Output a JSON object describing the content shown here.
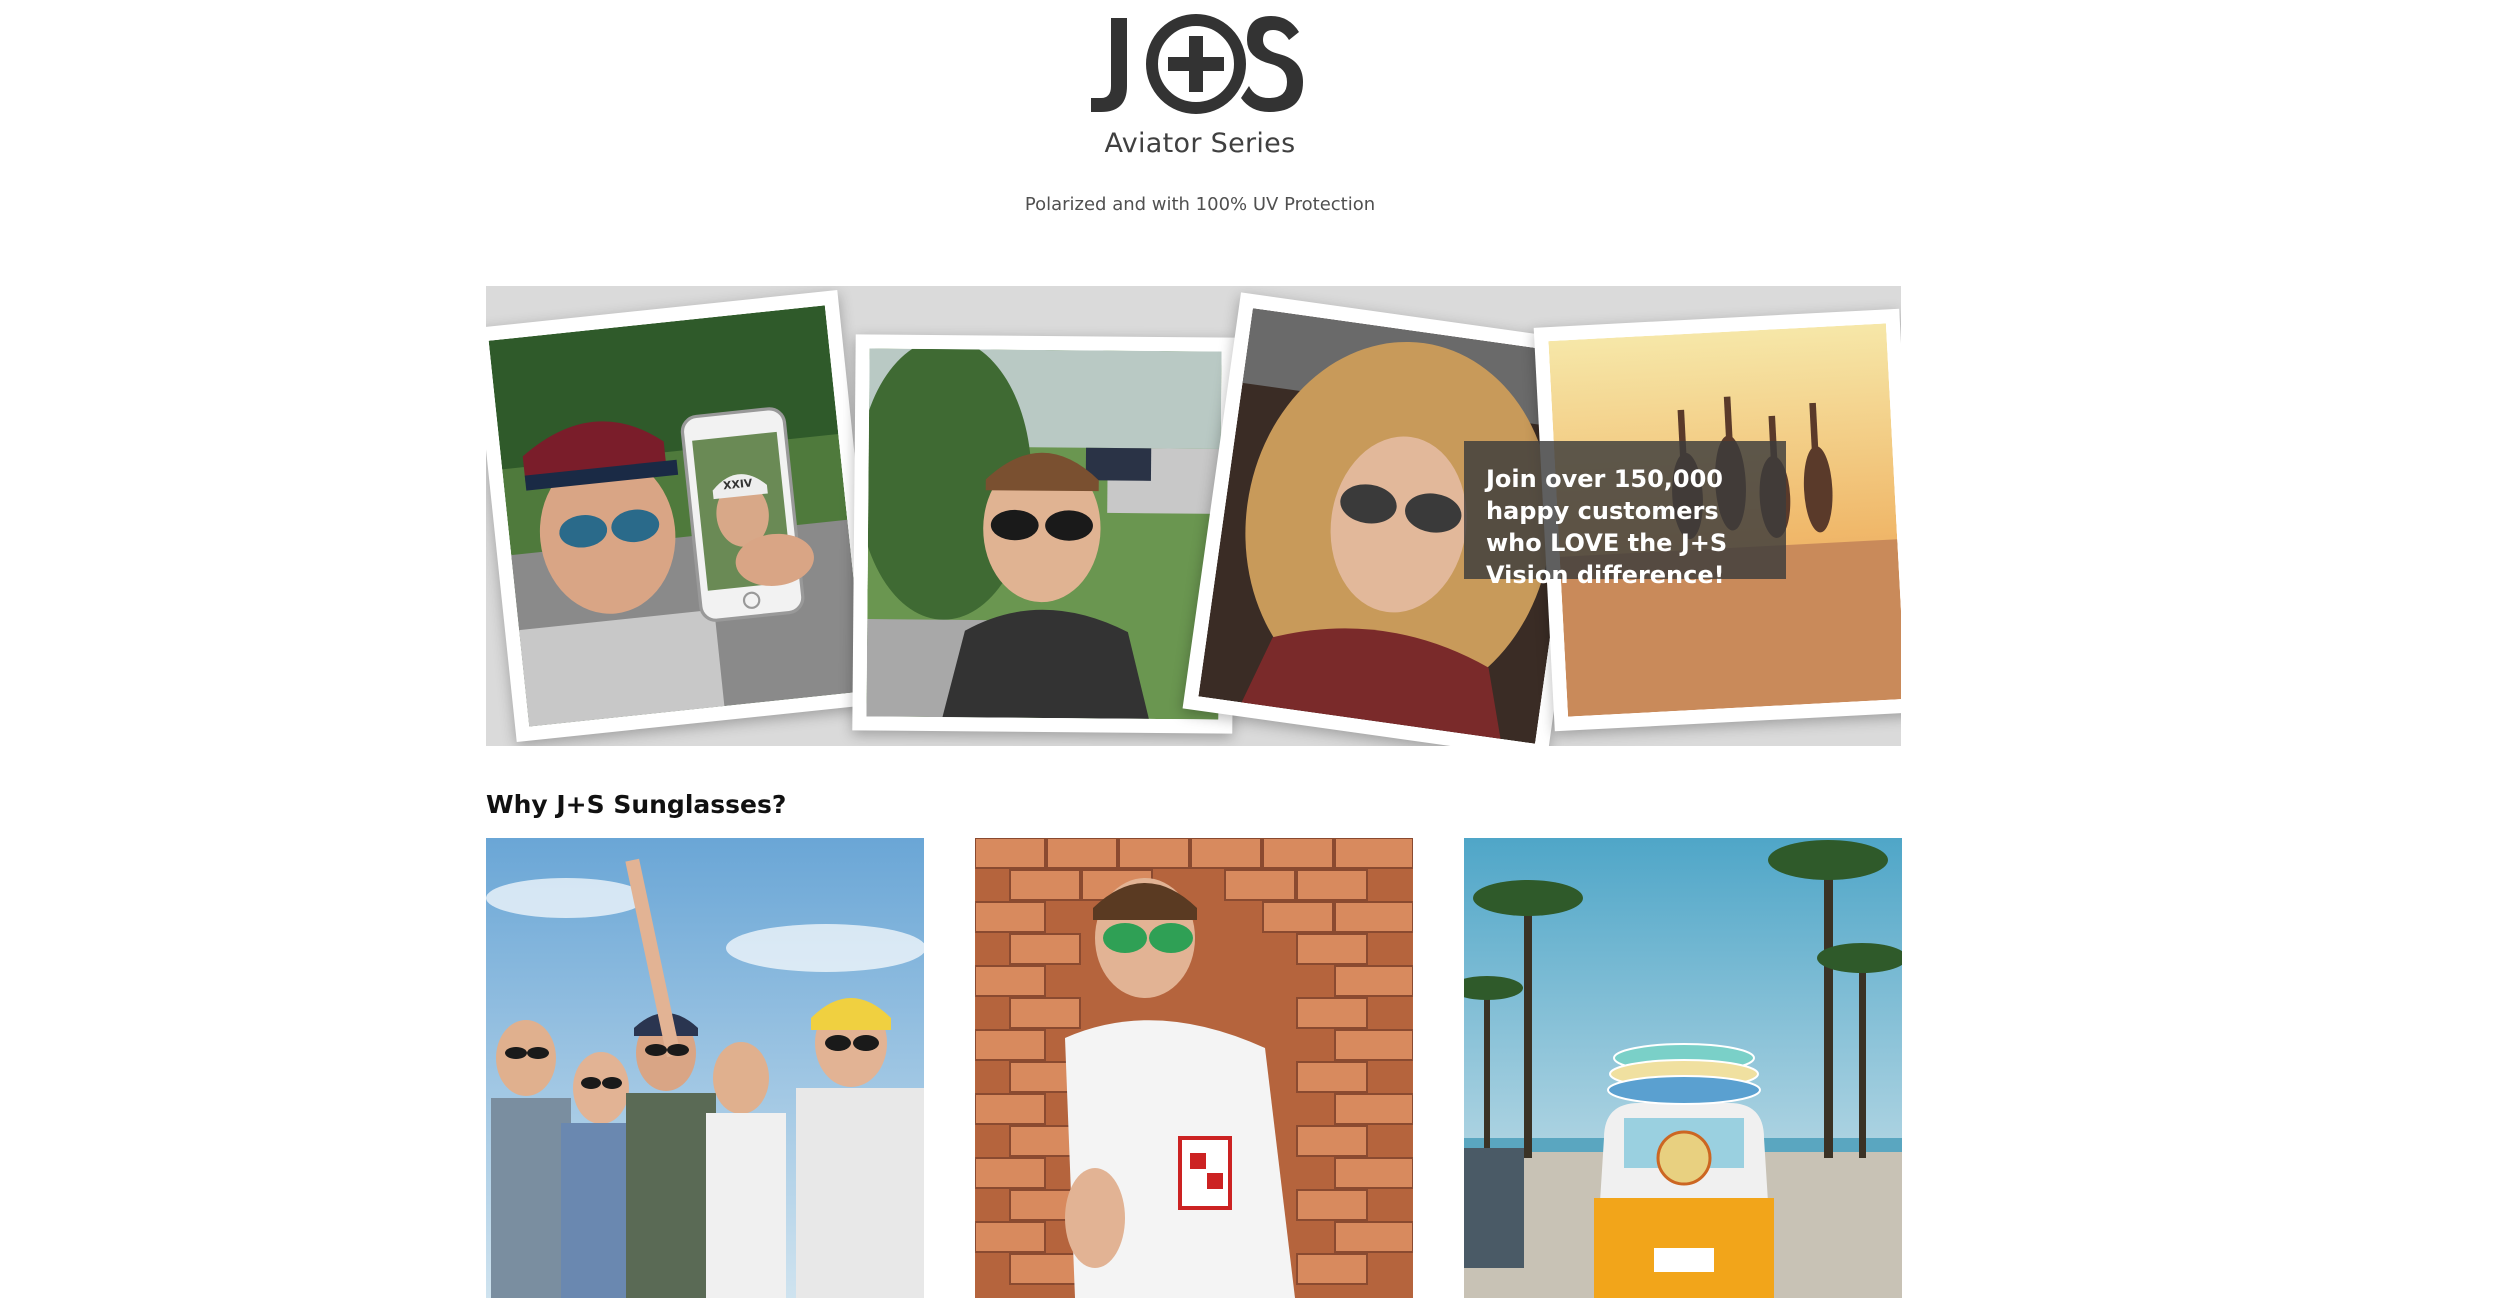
{
  "brand": {
    "logo_text": "J+S",
    "series": "Aviator Series",
    "tagline": "Polarized and with 100% UV Protection"
  },
  "hero": {
    "callout": "Join over 150,000 happy customers who LOVE the J+S Vision difference!",
    "photos": [
      {
        "subject": "woman with cap and phone showing selfie"
      },
      {
        "subject": "young man in sunglasses outdoors"
      },
      {
        "subject": "curly-haired woman in aviator sunglasses"
      },
      {
        "subject": "group jumping on beach at sunset"
      }
    ],
    "phone_cap_text": "XXIV"
  },
  "why": {
    "title": "Why J+S Sunglasses?",
    "tiles": [
      {
        "subject": "group of friends in sunglasses"
      },
      {
        "subject": "man in mirrored sunglasses against brick wall"
      },
      {
        "subject": "vintage van with surfboards under palm trees"
      }
    ]
  },
  "colors": {
    "banner_bg": "#dadada",
    "text_dark": "#111111",
    "logo": "#333333",
    "callout_bg": "rgba(60,60,60,0.82)"
  }
}
